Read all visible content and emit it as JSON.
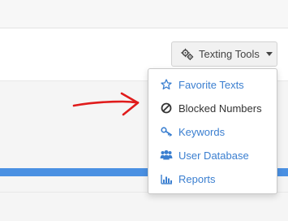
{
  "toolbar": {
    "texting_tools_label": "Texting Tools",
    "texting_tools_icon": "gears-icon"
  },
  "dropdown": {
    "items": [
      {
        "label": "Favorite Texts",
        "icon": "star-outline-icon"
      },
      {
        "label": "Blocked Numbers",
        "icon": "ban-icon"
      },
      {
        "label": "Keywords",
        "icon": "key-icon"
      },
      {
        "label": "User Database",
        "icon": "users-icon"
      },
      {
        "label": "Reports",
        "icon": "bar-chart-icon"
      }
    ]
  },
  "colors": {
    "link_blue": "#3b7fd0",
    "progress_blue": "#4a90e2",
    "annotation_red": "#e01b1b"
  }
}
